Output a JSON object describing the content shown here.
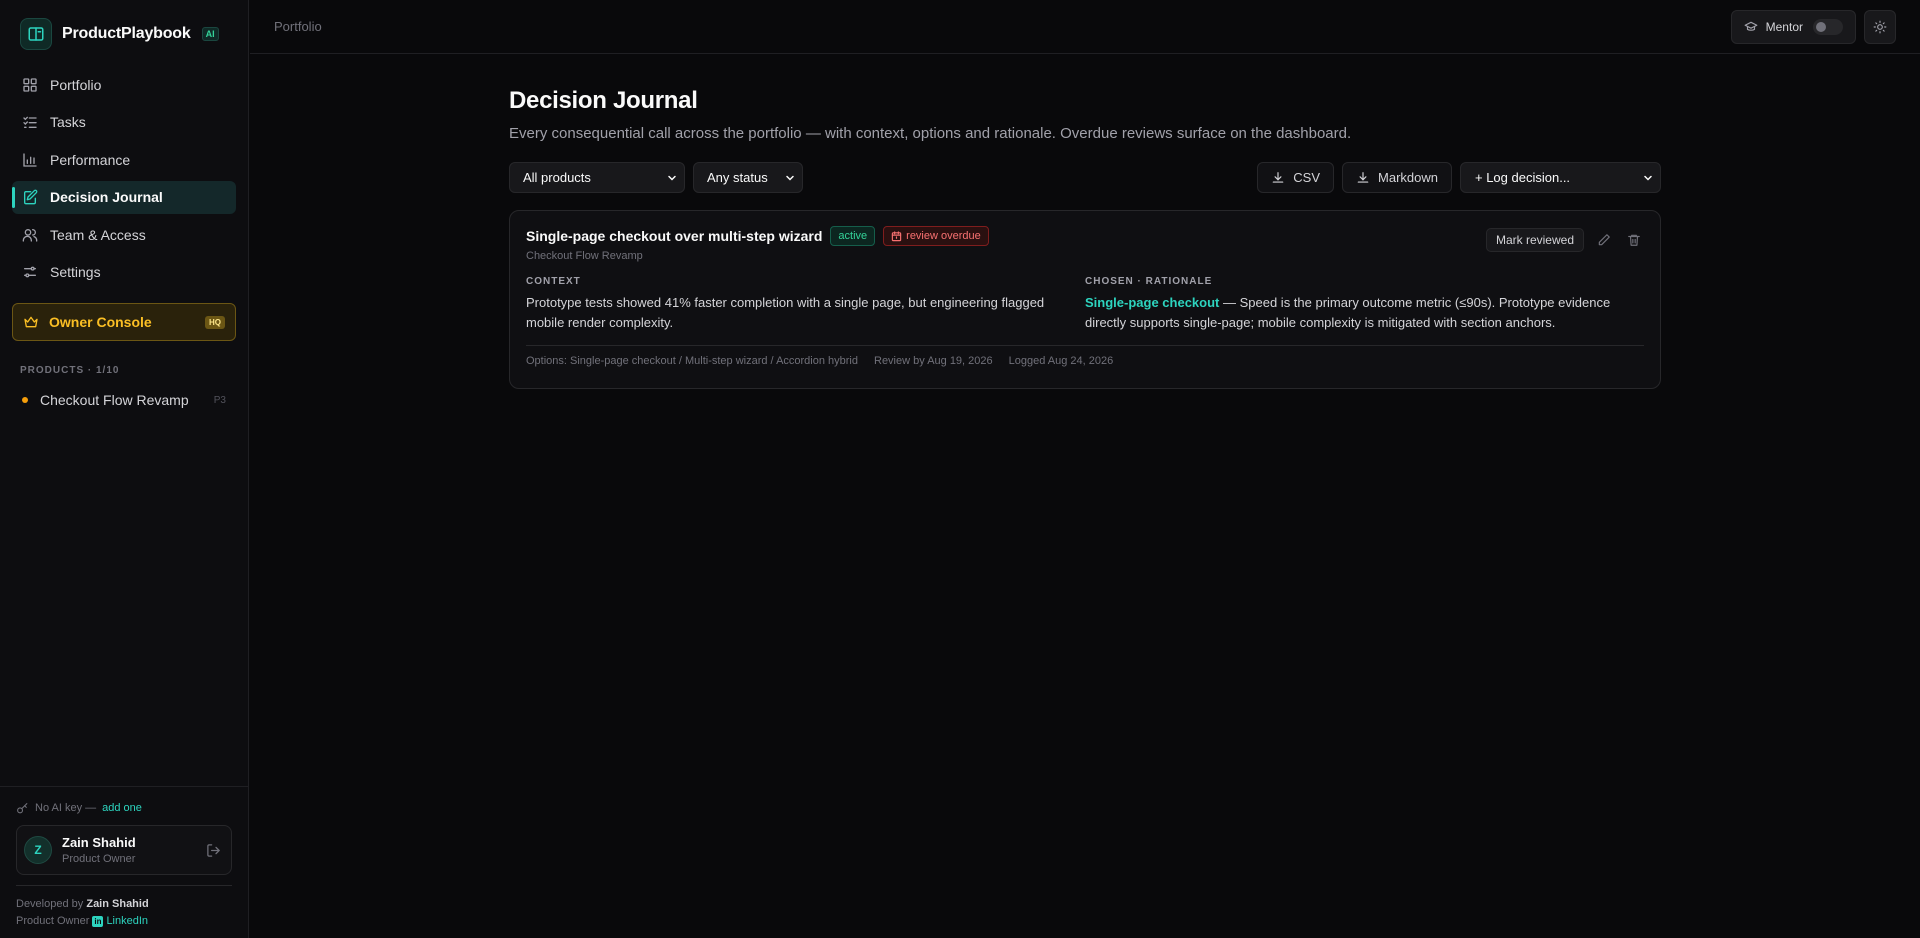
{
  "brand": {
    "name": "ProductPlaybook",
    "ai_badge": "AI"
  },
  "nav": {
    "items": [
      {
        "label": "Portfolio",
        "icon": "grid-icon"
      },
      {
        "label": "Tasks",
        "icon": "list-check-icon"
      },
      {
        "label": "Performance",
        "icon": "bar-chart-icon"
      },
      {
        "label": "Decision Journal",
        "icon": "notebook-pen-icon",
        "active": true
      },
      {
        "label": "Team & Access",
        "icon": "users-icon"
      },
      {
        "label": "Settings",
        "icon": "sliders-icon"
      }
    ],
    "owner_console": {
      "label": "Owner Console",
      "badge": "HQ"
    }
  },
  "products": {
    "heading": "PRODUCTS · 1/10",
    "items": [
      {
        "name": "Checkout Flow Revamp",
        "priority": "P3",
        "status_color": "#f59e0b"
      }
    ]
  },
  "sidebar_footer": {
    "ai_key_text": "No AI key —",
    "ai_key_link": "add one",
    "user": {
      "initial": "Z",
      "name": "Zain Shahid",
      "role": "Product Owner"
    },
    "credits": {
      "developed_by": "Developed by",
      "dev_name": "Zain Shahid",
      "dev_role": "Product Owner",
      "linkedin_label": "LinkedIn"
    }
  },
  "topbar": {
    "breadcrumb": "Portfolio",
    "mentor_label": "Mentor",
    "mentor_on": false
  },
  "page": {
    "title": "Decision Journal",
    "subtitle": "Every consequential call across the portfolio — with context, options and rationale. Overdue reviews surface on the dashboard."
  },
  "toolbar": {
    "product_filter": "All products",
    "status_filter": "Any status",
    "csv_label": "CSV",
    "markdown_label": "Markdown",
    "log_label": "+ Log decision..."
  },
  "decisions": [
    {
      "title": "Single-page checkout over multi-step wizard",
      "status": "active",
      "review_badge": "review overdue",
      "product": "Checkout Flow Revamp",
      "mark_label": "Mark reviewed",
      "context_label": "CONTEXT",
      "context": "Prototype tests showed 41% faster completion with a single page, but engineering flagged mobile render complexity.",
      "rationale_label": "CHOSEN · RATIONALE",
      "chosen": "Single-page checkout",
      "rationale": " — Speed is the primary outcome metric (≤90s). Prototype evidence directly supports single-page; mobile complexity is mitigated with section anchors.",
      "options": "Options: Single-page checkout / Multi-step wizard / Accordion hybrid",
      "review_by": "Review by Aug 19, 2026",
      "logged": "Logged Aug 24, 2026"
    }
  ],
  "colors": {
    "accent": "#2dd4bf",
    "owner": "#fbbf24",
    "danger": "#f87171",
    "background": "#09090b"
  }
}
